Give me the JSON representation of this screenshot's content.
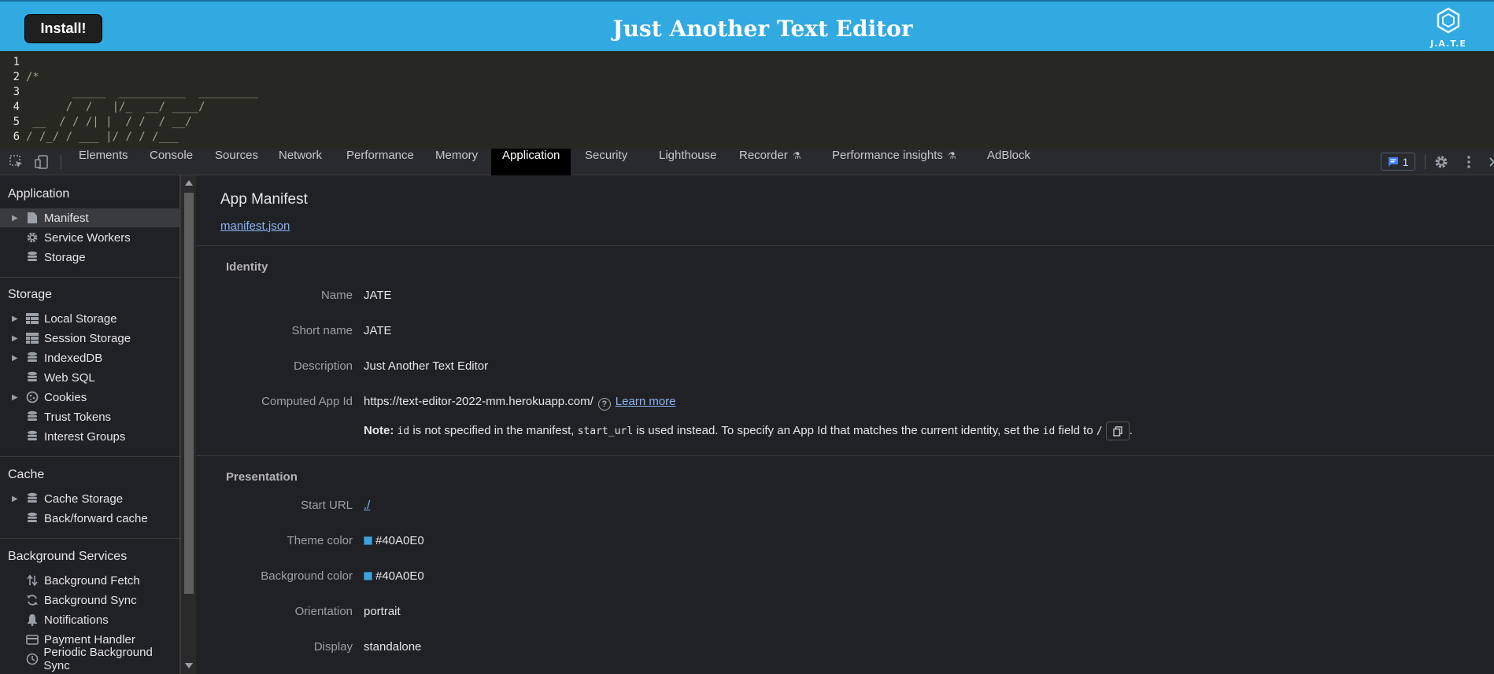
{
  "app": {
    "install_label": "Install!",
    "title": "Just Another Text Editor",
    "logo_text": "J.A.T.E"
  },
  "editor": {
    "lines": [
      {
        "num": "1",
        "code": ""
      },
      {
        "num": "2",
        "code": "/*"
      },
      {
        "num": "3",
        "code": "       _____  __________  _________"
      },
      {
        "num": "4",
        "code": "      /  /   |/_  __/ ____/"
      },
      {
        "num": "5",
        "code": " __  / / /| |  / /  / __/"
      },
      {
        "num": "6",
        "code": "/ /_/ / ___ |/ / / /___"
      }
    ]
  },
  "devtools": {
    "tabs": [
      "Elements",
      "Console",
      "Sources",
      "Network",
      "Performance",
      "Memory",
      "Application",
      "Security",
      "Lighthouse",
      "Recorder",
      "Performance insights",
      "AdBlock"
    ],
    "active_tab": "Application",
    "message_count": "1"
  },
  "sidebar": {
    "sections": [
      {
        "title": "Application",
        "items": [
          {
            "label": "Manifest",
            "icon": "file-icon",
            "expandable": true,
            "selected": true
          },
          {
            "label": "Service Workers",
            "icon": "gear-icon",
            "expandable": false
          },
          {
            "label": "Storage",
            "icon": "database-icon",
            "expandable": false
          }
        ]
      },
      {
        "title": "Storage",
        "items": [
          {
            "label": "Local Storage",
            "icon": "table-icon",
            "expandable": true
          },
          {
            "label": "Session Storage",
            "icon": "table-icon",
            "expandable": true
          },
          {
            "label": "IndexedDB",
            "icon": "database-icon",
            "expandable": true
          },
          {
            "label": "Web SQL",
            "icon": "database-icon",
            "expandable": false
          },
          {
            "label": "Cookies",
            "icon": "cookie-icon",
            "expandable": true
          },
          {
            "label": "Trust Tokens",
            "icon": "database-icon",
            "expandable": false
          },
          {
            "label": "Interest Groups",
            "icon": "database-icon",
            "expandable": false
          }
        ]
      },
      {
        "title": "Cache",
        "items": [
          {
            "label": "Cache Storage",
            "icon": "database-icon",
            "expandable": true
          },
          {
            "label": "Back/forward cache",
            "icon": "database-icon",
            "expandable": false
          }
        ]
      },
      {
        "title": "Background Services",
        "items": [
          {
            "label": "Background Fetch",
            "icon": "arrows-updown-icon",
            "expandable": false
          },
          {
            "label": "Background Sync",
            "icon": "sync-icon",
            "expandable": false
          },
          {
            "label": "Notifications",
            "icon": "bell-icon",
            "expandable": false
          },
          {
            "label": "Payment Handler",
            "icon": "card-icon",
            "expandable": false
          },
          {
            "label": "Periodic Background Sync",
            "icon": "clock-icon",
            "expandable": false
          }
        ]
      }
    ]
  },
  "manifest": {
    "title": "App Manifest",
    "link": "manifest.json",
    "identity": {
      "heading": "Identity",
      "name_label": "Name",
      "name": "JATE",
      "short_name_label": "Short name",
      "short_name": "JATE",
      "description_label": "Description",
      "description": "Just Another Text Editor",
      "app_id_label": "Computed App Id",
      "app_id": "https://text-editor-2022-mm.herokuapp.com/",
      "learn_more": "Learn more",
      "note_bold": "Note:",
      "note_code1": "id",
      "note_text1": "is not specified in the manifest,",
      "note_code2": "start_url",
      "note_text2": "is used instead. To specify an App Id that matches the current identity, set the",
      "note_code3": "id",
      "note_text3": "field to",
      "note_code4": "/",
      "note_end": "."
    },
    "presentation": {
      "heading": "Presentation",
      "start_url_label": "Start URL",
      "start_url": "./",
      "theme_color_label": "Theme color",
      "theme_color": "#40A0E0",
      "bg_color_label": "Background color",
      "bg_color": "#40A0E0",
      "orientation_label": "Orientation",
      "orientation": "portrait",
      "display_label": "Display",
      "display": "standalone"
    }
  },
  "colors": {
    "header": "#31a9e1",
    "swatch": "#40a0e0",
    "link": "#8ab4f8"
  }
}
